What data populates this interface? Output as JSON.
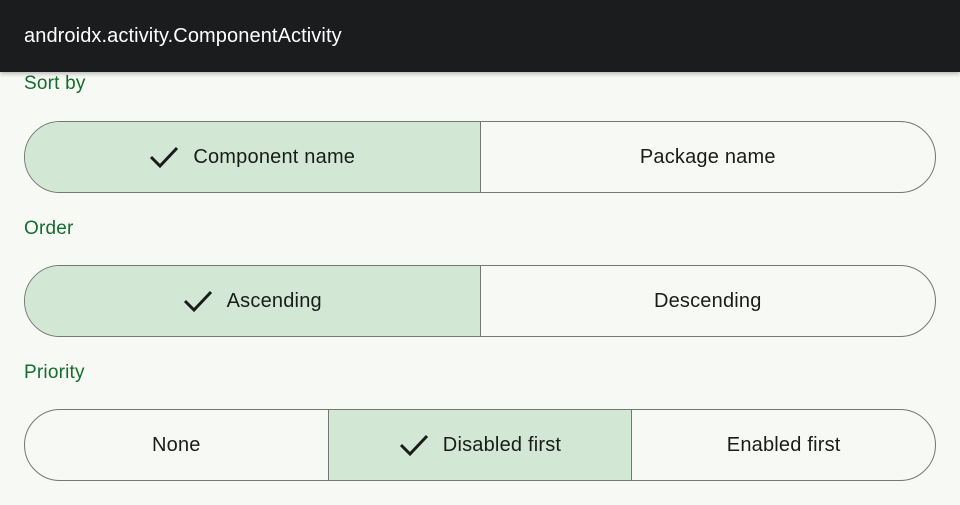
{
  "app_bar": {
    "title": "androidx.activity.ComponentActivity"
  },
  "colors": {
    "label_green": "#146c2e",
    "selected_bg": "#d2e8d4",
    "outline": "#737972",
    "background": "#f7faf4",
    "app_bar_bg": "#1b1c1e"
  },
  "sections": [
    {
      "label": "Sort by",
      "options": [
        {
          "label": "Component name",
          "selected": true
        },
        {
          "label": "Package name",
          "selected": false
        }
      ]
    },
    {
      "label": "Order",
      "options": [
        {
          "label": "Ascending",
          "selected": true
        },
        {
          "label": "Descending",
          "selected": false
        }
      ]
    },
    {
      "label": "Priority",
      "options": [
        {
          "label": "None",
          "selected": false
        },
        {
          "label": "Disabled first",
          "selected": true
        },
        {
          "label": "Enabled first",
          "selected": false
        }
      ]
    }
  ]
}
